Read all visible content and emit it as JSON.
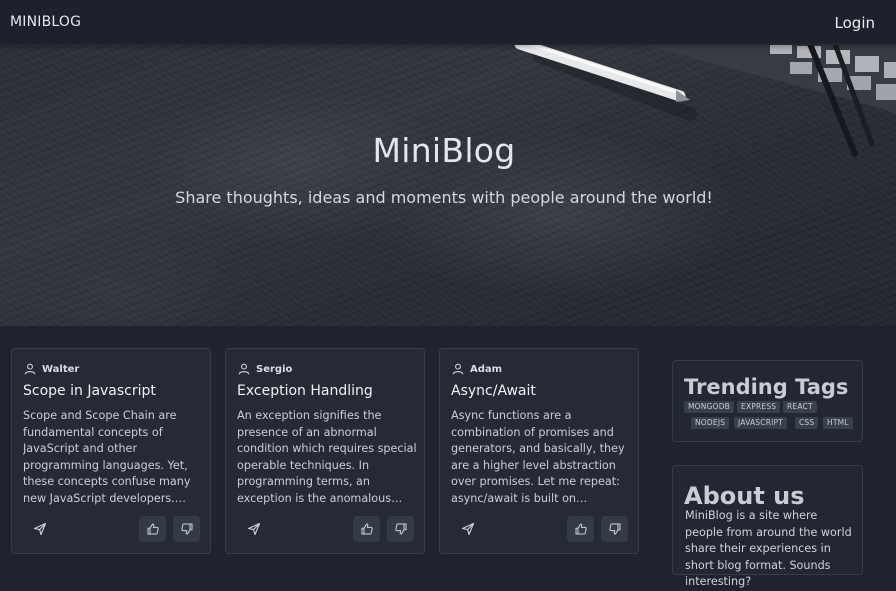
{
  "nav": {
    "brand": "MINIBLOG",
    "login": "Login"
  },
  "hero": {
    "title": "MiniBlog",
    "subtitle": "Share thoughts, ideas and moments with people around the world!"
  },
  "posts": [
    {
      "author": "Walter",
      "title": "Scope in Javascript",
      "body": "Scope and Scope Chain are fundamental concepts of JavaScript and other programming languages. Yet, these concepts confuse many new JavaScript developers. The…"
    },
    {
      "author": "Sergio",
      "title": "Exception Handling",
      "body": "An exception signifies the presence of an abnormal condition which requires special operable techniques. In programming terms, an exception is the anomalous code that…"
    },
    {
      "author": "Adam",
      "title": "Async/Await",
      "body": "Async functions are a combination of promises and generators, and basically, they are a higher level abstraction over promises. Let me repeat: async/await is built on promises…"
    }
  ],
  "icons": {
    "author": "user-icon",
    "share": "send-icon",
    "like": "thumbs-up-icon",
    "dislike": "thumbs-down-icon"
  },
  "trending": {
    "title": "Trending Tags",
    "tags": [
      "MONGODB",
      "EXPRESS",
      "REACT",
      "NODEJS",
      "JAVASCRIPT",
      "CSS",
      "HTML"
    ]
  },
  "about": {
    "title": "About us",
    "text": "MiniBlog is a site where people from around the world share their experiences in short blog format. Sounds interesting?"
  },
  "colors": {
    "page_bg": "#1f232d",
    "card_bg": "#252a35",
    "card_border": "#363c49",
    "button_bg": "#343a47",
    "tag_bg": "#39404d"
  }
}
